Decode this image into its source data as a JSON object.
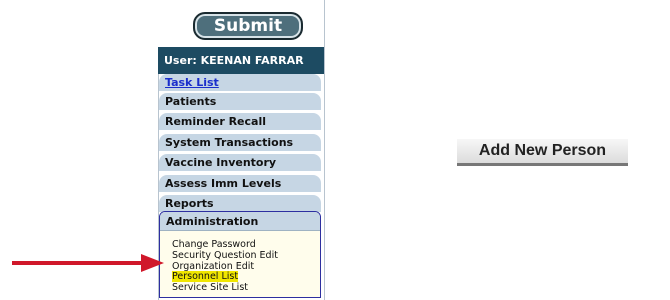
{
  "form": {
    "submit_label": "Submit"
  },
  "user": {
    "label": "User: KEENAN FARRAR"
  },
  "nav": {
    "items": [
      {
        "label": "Task List"
      },
      {
        "label": "Patients"
      },
      {
        "label": "Reminder Recall"
      },
      {
        "label": "System Transactions"
      },
      {
        "label": "Vaccine Inventory"
      },
      {
        "label": "Assess Imm Levels"
      },
      {
        "label": "Reports"
      }
    ],
    "admin": {
      "label": "Administration",
      "links": [
        {
          "label": "Change Password"
        },
        {
          "label": "Security Question Edit"
        },
        {
          "label": "Organization Edit"
        },
        {
          "label": "Personnel List",
          "highlighted": true
        },
        {
          "label": "Service Site List"
        }
      ]
    }
  },
  "main": {
    "add_button_label": "Add New Person"
  },
  "annotation": {
    "arrow_color": "#d0182a"
  }
}
